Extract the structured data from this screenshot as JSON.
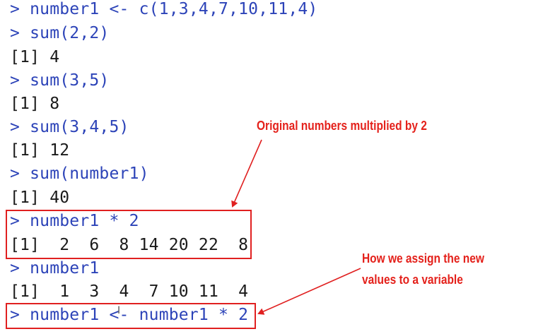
{
  "console": {
    "lines": [
      {
        "kind": "cmd",
        "text": "> number1 <- c(1,3,4,7,10,11,4)"
      },
      {
        "kind": "cmd",
        "text": "> sum(2,2)"
      },
      {
        "kind": "out",
        "text": "[1] 4"
      },
      {
        "kind": "cmd",
        "text": "> sum(3,5)"
      },
      {
        "kind": "out",
        "text": "[1] 8"
      },
      {
        "kind": "cmd",
        "text": "> sum(3,4,5)"
      },
      {
        "kind": "out",
        "text": "[1] 12"
      },
      {
        "kind": "cmd",
        "text": "> sum(number1)"
      },
      {
        "kind": "out",
        "text": "[1] 40"
      },
      {
        "kind": "cmd",
        "text": "> number1 * 2"
      },
      {
        "kind": "out",
        "text": "[1]  2  6  8 14 20 22  8"
      },
      {
        "kind": "cmd",
        "text": "> number1"
      },
      {
        "kind": "out",
        "text": "[1]  1  3  4  7 10 11  4"
      },
      {
        "kind": "cmd",
        "text": "> number1 <- number1 * 2"
      }
    ]
  },
  "annotations": {
    "multiply_note": "Original numbers multiplied by 2",
    "assign_note_line1": "How we assign the new",
    "assign_note_line2": "values to a variable"
  },
  "colors": {
    "command": "#2c43b8",
    "output": "#1a1a1a",
    "highlight": "#e02020"
  },
  "cursor_icon": "text-cursor-icon"
}
